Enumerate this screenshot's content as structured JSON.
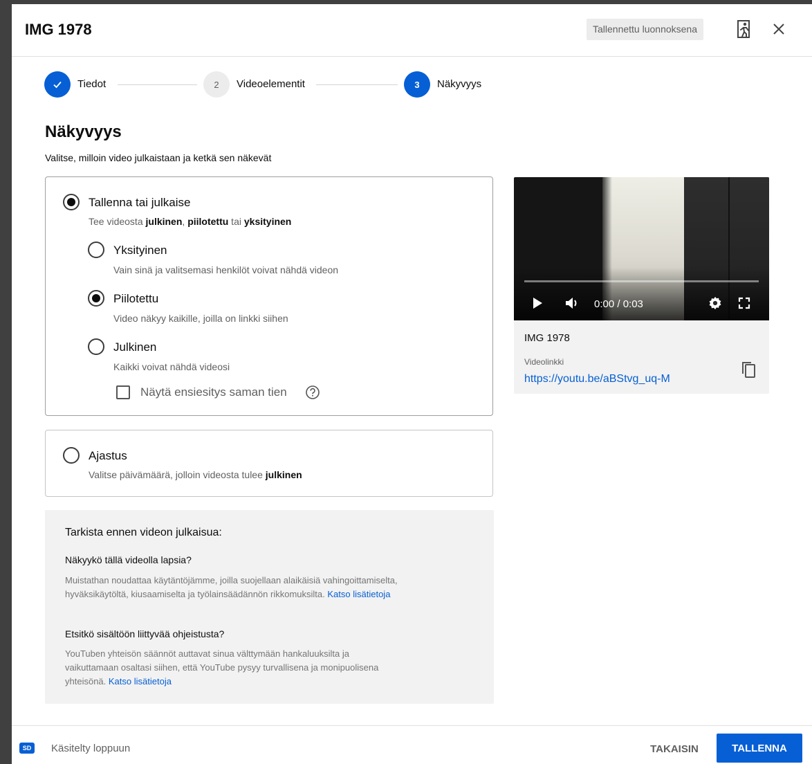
{
  "header": {
    "title": "IMG 1978",
    "draft_badge": "Tallennettu luonnoksena",
    "exit_icon": "exit-icon",
    "close_icon": "close-icon"
  },
  "stepper": {
    "steps": [
      {
        "number": "",
        "label": "Tiedot",
        "state": "done"
      },
      {
        "number": "2",
        "label": "Videoelementit",
        "state": "pending"
      },
      {
        "number": "3",
        "label": "Näkyvyys",
        "state": "active"
      }
    ]
  },
  "section": {
    "title": "Näkyvyys",
    "subtitle": "Valitse, milloin video julkaistaan ja ketkä sen näkevät"
  },
  "save_publish": {
    "label": "Tallenna tai julkaise",
    "desc_prefix": "Tee videosta ",
    "desc_public": "julkinen",
    "desc_sep1": ", ",
    "desc_unlisted": "piilotettu",
    "desc_sep2": " tai ",
    "desc_private": "yksityinen",
    "selected": true,
    "options": [
      {
        "label": "Yksityinen",
        "desc": "Vain sinä ja valitsemasi henkilöt voivat nähdä videon",
        "selected": false
      },
      {
        "label": "Piilotettu",
        "desc": "Video näkyy kaikille, joilla on linkki siihen",
        "selected": true
      },
      {
        "label": "Julkinen",
        "desc": "Kaikki voivat nähdä videosi",
        "selected": false
      }
    ],
    "premiere_checkbox": "Näytä ensiesitys saman tien",
    "premiere_checked": false
  },
  "schedule": {
    "label": "Ajastus",
    "desc_prefix": "Valitse päivämäärä, jolloin videosta tulee ",
    "desc_bold": "julkinen",
    "selected": false
  },
  "checklist": {
    "title": "Tarkista ennen videon julkaisua:",
    "q1": "Näkyykö tällä videolla lapsia?",
    "p1": "Muistathan noudattaa käytäntöjämme, joilla suojellaan alaikäisiä vahingoittamiselta, hyväksikäytöltä, kiusaamiselta ja työlainsäädännön rikkomuksilta.",
    "link1": "Katso lisätietoja",
    "q2": "Etsitkö sisältöön liittyvää ohjeistusta?",
    "p2": "YouTuben yhteisön säännöt auttavat sinua välttymään hankaluuksilta ja vaikuttamaan osaltasi siihen, että YouTube pysyy turvallisena ja monipuolisena yhteisönä.",
    "link2": "Katso lisätietoja"
  },
  "preview": {
    "time": "0:00 / 0:03",
    "progress": 0,
    "title": "IMG 1978",
    "link_label": "Videolinkki",
    "link": "https://youtu.be/aBStvg_uq-M"
  },
  "footer": {
    "quality_badge": "SD",
    "status": "Käsitelty loppuun",
    "back_label": "TAKAISIN",
    "save_label": "TALLENNA"
  },
  "colors": {
    "accent": "#065fd4",
    "muted_text": "#606060",
    "panel_bg": "#f2f2f2"
  }
}
